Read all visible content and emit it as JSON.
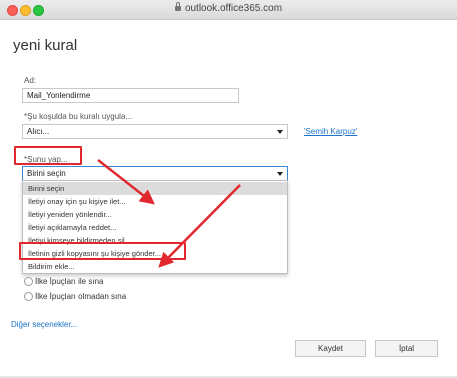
{
  "browser": {
    "url": "outlook.office365.com"
  },
  "page": {
    "title": "yeni kural"
  },
  "form": {
    "name_label": "Ad:",
    "name_value": "Mail_Yonlendirme",
    "condition_label": "*Şu koşulda bu kuralı uygula...",
    "condition_value": "Alıcı...",
    "condition_link": "'Semih Karpuz'",
    "action_label": "*Şunu yap...",
    "action_value": "Birini seçin"
  },
  "dropdown": {
    "options": [
      "Birini seçin",
      "İletiyi onay için şu kişiye ilet...",
      "İletiyi yeniden yönlendir...",
      "İletiyi açıklamayla reddet...",
      "İletiyi kimseye bildirmeden sil",
      "İletinin gizli kopyasını şu kişiye gönder...",
      "Bildirim ekle..."
    ],
    "selected_index": 0
  },
  "radios": [
    {
      "label": "İlke İpuçları ile sına"
    },
    {
      "label": "İlke İpuçları olmadan sına"
    }
  ],
  "more_options": "Diğer seçenekler...",
  "buttons": {
    "save": "Kaydet",
    "cancel": "İptal"
  },
  "colors": {
    "annotation_red": "#e0282e",
    "link_blue": "#1a73c9",
    "focus_blue": "#3a88d6"
  },
  "icons": {
    "lock": "lock-icon",
    "caret": "chevron-down-icon"
  }
}
